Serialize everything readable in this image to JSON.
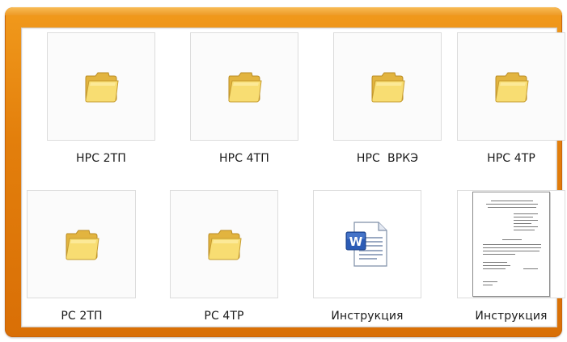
{
  "items": [
    {
      "label": "НРС 2ТП",
      "icon": "folder-icon"
    },
    {
      "label": "НРС 4ТП",
      "icon": "folder-icon"
    },
    {
      "label": "НРС  ВРКЭ",
      "icon": "folder-icon"
    },
    {
      "label": "НРС 4ТР",
      "icon": "folder-icon"
    },
    {
      "label": "РС 2ТП",
      "icon": "folder-icon"
    },
    {
      "label": "РС 4ТР",
      "icon": "folder-icon"
    },
    {
      "label": "Инструкция",
      "icon": "word-document-icon"
    },
    {
      "label": "Инструкция",
      "icon": "document-preview-icon"
    }
  ],
  "colors": {
    "frame": "#e8860f",
    "folder": "#f6d35e"
  }
}
